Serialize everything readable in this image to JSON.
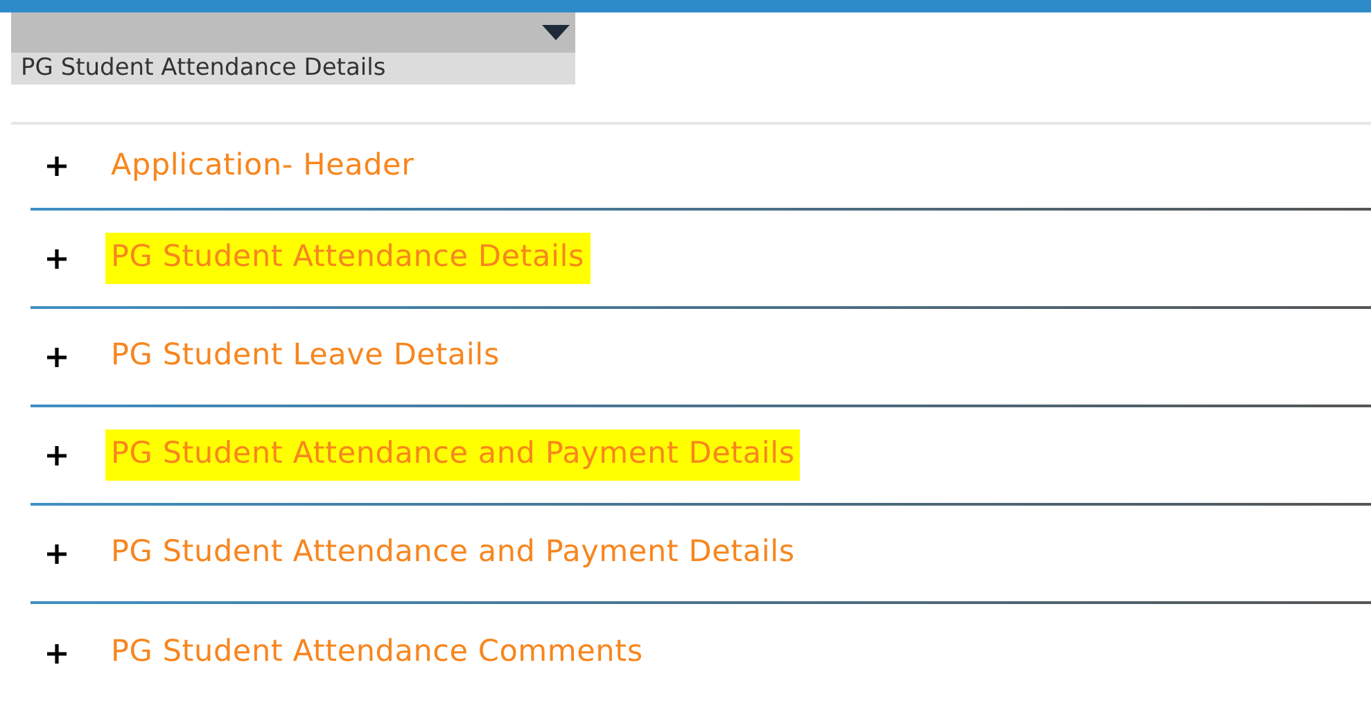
{
  "dropdown": {
    "selected_option": "PG Student Attendance Details"
  },
  "sections": [
    {
      "title": "Application- Header",
      "expanded": false,
      "highlighted": false
    },
    {
      "title": "PG Student Attendance Details",
      "expanded": false,
      "highlighted": true
    },
    {
      "title": "PG Student Leave Details",
      "expanded": false,
      "highlighted": false
    },
    {
      "title": "PG Student Attendance and Payment Details",
      "expanded": false,
      "highlighted": true
    },
    {
      "title": "PG Student Attendance and Payment Details",
      "expanded": false,
      "highlighted": false
    },
    {
      "title": "PG Student Attendance Comments",
      "expanded": false,
      "highlighted": false
    }
  ]
}
